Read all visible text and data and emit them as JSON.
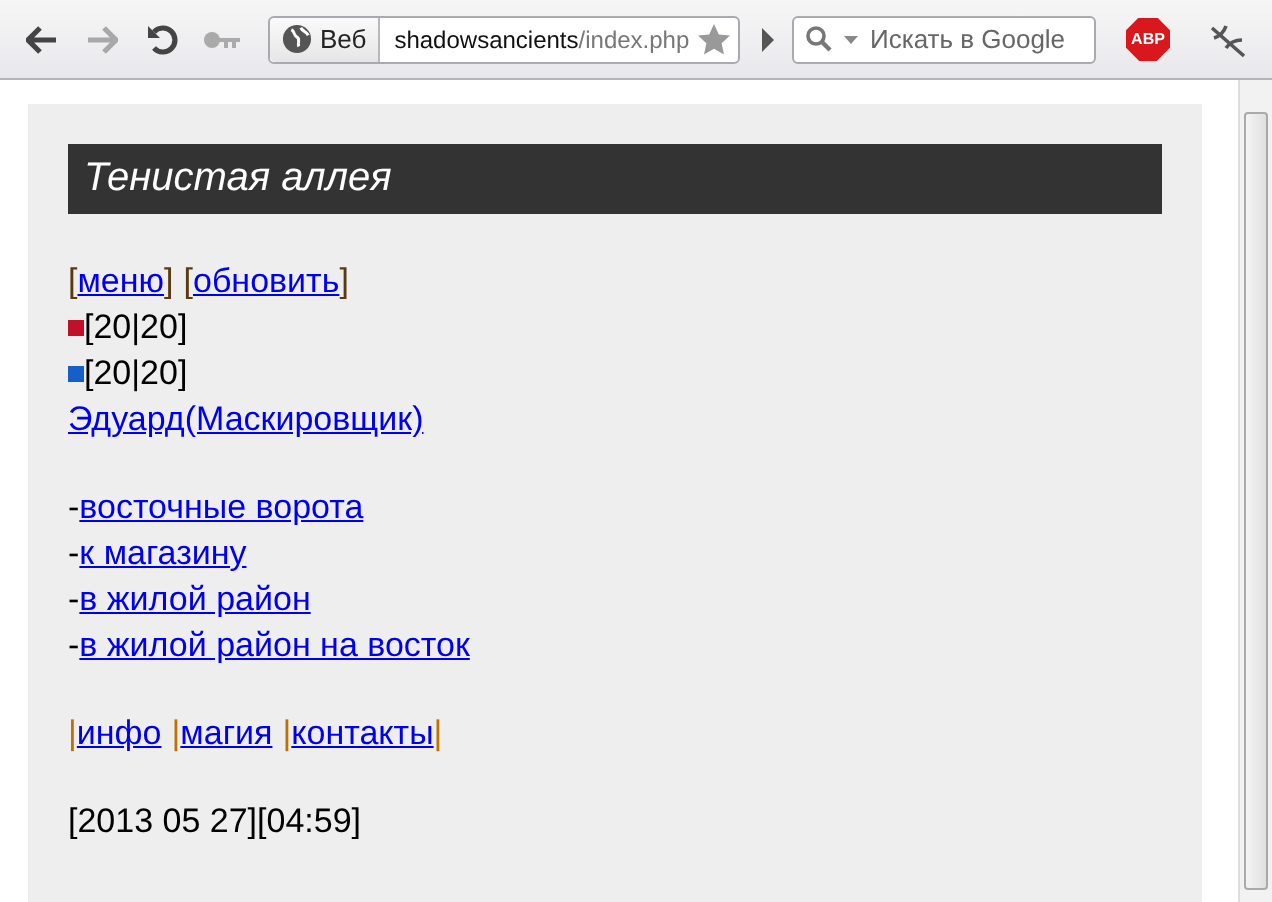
{
  "browser": {
    "scheme_label": "Веб",
    "url_host": "shadowsancients",
    "url_path": "/index.php",
    "search": {
      "placeholder": "Искать в Google"
    },
    "adblock_label": "ABP"
  },
  "page": {
    "title": "Тенистая аллея",
    "menu": [
      {
        "open": "[",
        "label": "меню",
        "close": "]"
      },
      {
        "open": "[",
        "label": "обновить",
        "close": "]"
      }
    ],
    "gauges": [
      {
        "reading": "[20|20]",
        "color": "#c0102a"
      },
      {
        "reading": "[20|20]",
        "color": "#1560c8"
      }
    ],
    "player": "Эдуард(Маскировщик)",
    "exits": [
      {
        "prefix": "-",
        "label": "восточные ворота"
      },
      {
        "prefix": "-",
        "label": "к магазину"
      },
      {
        "prefix": "-",
        "label": "в жилой район"
      },
      {
        "prefix": "-",
        "label": "в жилой район на восток"
      }
    ],
    "footer_links": [
      {
        "sep": "|",
        "label": "инфо"
      },
      {
        "sep": "|",
        "label": "магия"
      },
      {
        "sep": "|",
        "label": "контакты"
      }
    ],
    "footer_end": "|",
    "datetime": "[2013 05 27][04:59]"
  }
}
